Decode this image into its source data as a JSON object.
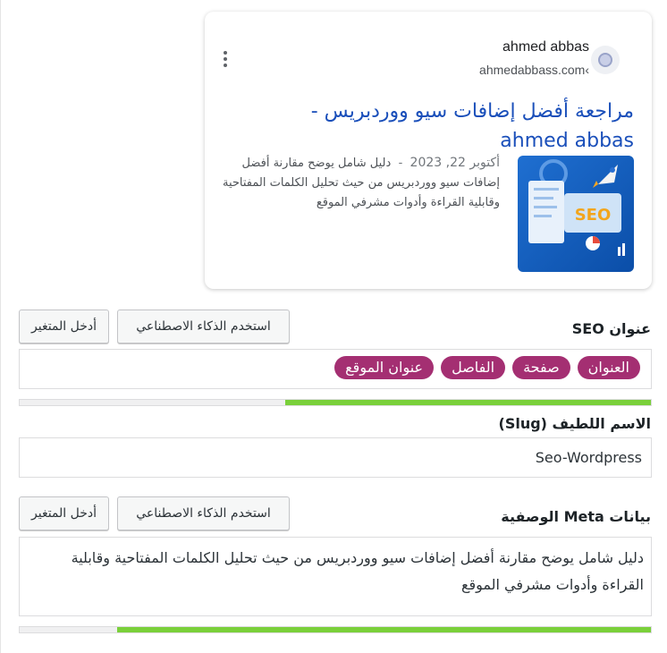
{
  "preview": {
    "site_name": "ahmed abbas",
    "site_url": "ahmedabbass.com‹",
    "title": "مراجعة أفضل إضافات سيو ووردبريس - ahmed abbas",
    "date": "أكتوبر 22, 2023",
    "separator": "-",
    "description": "دليل شامل يوضح مقارنة أفضل إضافات سيو ووردبريس من حيث تحليل الكلمات المفتاحية وقابلية القراءة وأدوات مشرفي الموقع",
    "thumbnail_text": "SEO"
  },
  "seo_title": {
    "label": "عنوان SEO",
    "ai_button": "استخدم الذكاء الاصطناعي",
    "var_button": "أدخل المتغير",
    "chips": [
      "العنوان",
      "صفحة",
      "الفاصل",
      "عنوان الموقع"
    ],
    "progress": 0.58
  },
  "slug": {
    "label": "الاسم اللطيف (Slug)",
    "value": "Seo-Wordpress"
  },
  "meta": {
    "label": "بيانات Meta الوصفية",
    "ai_button": "استخدم الذكاء الاصطناعي",
    "var_button": "أدخل المتغير",
    "value": "دليل شامل يوضح مقارنة أفضل إضافات سيو ووردبريس من حيث تحليل الكلمات المفتاحية وقابلية القراءة وأدوات مشرفي الموقع",
    "progress": 0.845
  },
  "colors": {
    "chip": "#a42f72",
    "progress_good": "#7ad03a",
    "link": "#1a4fba"
  }
}
